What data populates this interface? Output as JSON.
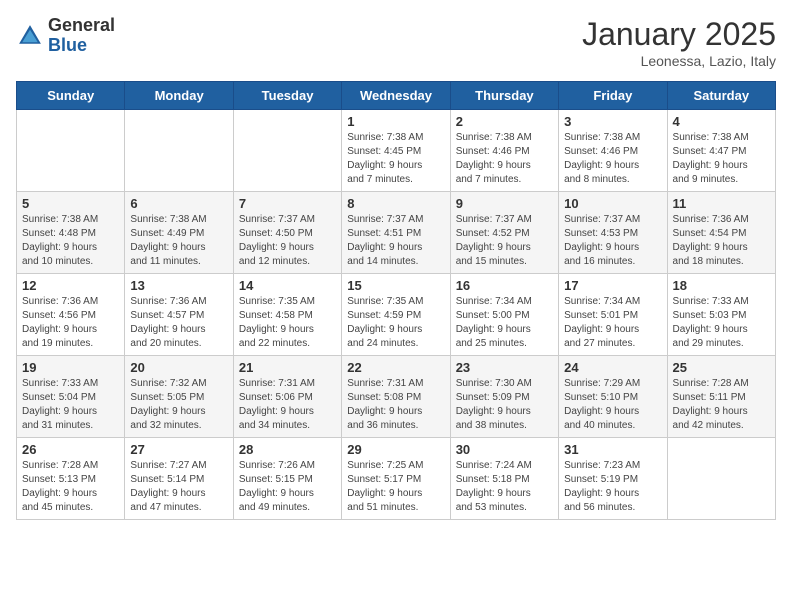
{
  "logo": {
    "general": "General",
    "blue": "Blue"
  },
  "header": {
    "month": "January 2025",
    "location": "Leonessa, Lazio, Italy"
  },
  "weekdays": [
    "Sunday",
    "Monday",
    "Tuesday",
    "Wednesday",
    "Thursday",
    "Friday",
    "Saturday"
  ],
  "weeks": [
    [
      {
        "day": "",
        "info": ""
      },
      {
        "day": "",
        "info": ""
      },
      {
        "day": "",
        "info": ""
      },
      {
        "day": "1",
        "info": "Sunrise: 7:38 AM\nSunset: 4:45 PM\nDaylight: 9 hours\nand 7 minutes."
      },
      {
        "day": "2",
        "info": "Sunrise: 7:38 AM\nSunset: 4:46 PM\nDaylight: 9 hours\nand 7 minutes."
      },
      {
        "day": "3",
        "info": "Sunrise: 7:38 AM\nSunset: 4:46 PM\nDaylight: 9 hours\nand 8 minutes."
      },
      {
        "day": "4",
        "info": "Sunrise: 7:38 AM\nSunset: 4:47 PM\nDaylight: 9 hours\nand 9 minutes."
      }
    ],
    [
      {
        "day": "5",
        "info": "Sunrise: 7:38 AM\nSunset: 4:48 PM\nDaylight: 9 hours\nand 10 minutes."
      },
      {
        "day": "6",
        "info": "Sunrise: 7:38 AM\nSunset: 4:49 PM\nDaylight: 9 hours\nand 11 minutes."
      },
      {
        "day": "7",
        "info": "Sunrise: 7:37 AM\nSunset: 4:50 PM\nDaylight: 9 hours\nand 12 minutes."
      },
      {
        "day": "8",
        "info": "Sunrise: 7:37 AM\nSunset: 4:51 PM\nDaylight: 9 hours\nand 14 minutes."
      },
      {
        "day": "9",
        "info": "Sunrise: 7:37 AM\nSunset: 4:52 PM\nDaylight: 9 hours\nand 15 minutes."
      },
      {
        "day": "10",
        "info": "Sunrise: 7:37 AM\nSunset: 4:53 PM\nDaylight: 9 hours\nand 16 minutes."
      },
      {
        "day": "11",
        "info": "Sunrise: 7:36 AM\nSunset: 4:54 PM\nDaylight: 9 hours\nand 18 minutes."
      }
    ],
    [
      {
        "day": "12",
        "info": "Sunrise: 7:36 AM\nSunset: 4:56 PM\nDaylight: 9 hours\nand 19 minutes."
      },
      {
        "day": "13",
        "info": "Sunrise: 7:36 AM\nSunset: 4:57 PM\nDaylight: 9 hours\nand 20 minutes."
      },
      {
        "day": "14",
        "info": "Sunrise: 7:35 AM\nSunset: 4:58 PM\nDaylight: 9 hours\nand 22 minutes."
      },
      {
        "day": "15",
        "info": "Sunrise: 7:35 AM\nSunset: 4:59 PM\nDaylight: 9 hours\nand 24 minutes."
      },
      {
        "day": "16",
        "info": "Sunrise: 7:34 AM\nSunset: 5:00 PM\nDaylight: 9 hours\nand 25 minutes."
      },
      {
        "day": "17",
        "info": "Sunrise: 7:34 AM\nSunset: 5:01 PM\nDaylight: 9 hours\nand 27 minutes."
      },
      {
        "day": "18",
        "info": "Sunrise: 7:33 AM\nSunset: 5:03 PM\nDaylight: 9 hours\nand 29 minutes."
      }
    ],
    [
      {
        "day": "19",
        "info": "Sunrise: 7:33 AM\nSunset: 5:04 PM\nDaylight: 9 hours\nand 31 minutes."
      },
      {
        "day": "20",
        "info": "Sunrise: 7:32 AM\nSunset: 5:05 PM\nDaylight: 9 hours\nand 32 minutes."
      },
      {
        "day": "21",
        "info": "Sunrise: 7:31 AM\nSunset: 5:06 PM\nDaylight: 9 hours\nand 34 minutes."
      },
      {
        "day": "22",
        "info": "Sunrise: 7:31 AM\nSunset: 5:08 PM\nDaylight: 9 hours\nand 36 minutes."
      },
      {
        "day": "23",
        "info": "Sunrise: 7:30 AM\nSunset: 5:09 PM\nDaylight: 9 hours\nand 38 minutes."
      },
      {
        "day": "24",
        "info": "Sunrise: 7:29 AM\nSunset: 5:10 PM\nDaylight: 9 hours\nand 40 minutes."
      },
      {
        "day": "25",
        "info": "Sunrise: 7:28 AM\nSunset: 5:11 PM\nDaylight: 9 hours\nand 42 minutes."
      }
    ],
    [
      {
        "day": "26",
        "info": "Sunrise: 7:28 AM\nSunset: 5:13 PM\nDaylight: 9 hours\nand 45 minutes."
      },
      {
        "day": "27",
        "info": "Sunrise: 7:27 AM\nSunset: 5:14 PM\nDaylight: 9 hours\nand 47 minutes."
      },
      {
        "day": "28",
        "info": "Sunrise: 7:26 AM\nSunset: 5:15 PM\nDaylight: 9 hours\nand 49 minutes."
      },
      {
        "day": "29",
        "info": "Sunrise: 7:25 AM\nSunset: 5:17 PM\nDaylight: 9 hours\nand 51 minutes."
      },
      {
        "day": "30",
        "info": "Sunrise: 7:24 AM\nSunset: 5:18 PM\nDaylight: 9 hours\nand 53 minutes."
      },
      {
        "day": "31",
        "info": "Sunrise: 7:23 AM\nSunset: 5:19 PM\nDaylight: 9 hours\nand 56 minutes."
      },
      {
        "day": "",
        "info": ""
      }
    ]
  ]
}
